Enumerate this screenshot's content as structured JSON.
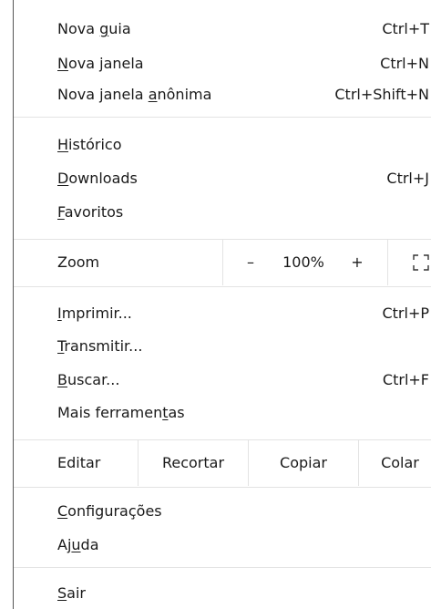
{
  "section1": [
    {
      "pre": "Nova ",
      "acc": "g",
      "post": "uia",
      "shortcut": "Ctrl+T"
    },
    {
      "pre": "",
      "acc": "N",
      "post": "ova janela",
      "shortcut": "Ctrl+N"
    },
    {
      "pre": "Nova janela ",
      "acc": "a",
      "post": "nônima",
      "shortcut": "Ctrl+Shift+N"
    }
  ],
  "section2": [
    {
      "pre": "",
      "acc": "H",
      "post": "istórico",
      "shortcut": ""
    },
    {
      "pre": "",
      "acc": "D",
      "post": "ownloads",
      "shortcut": "Ctrl+J"
    },
    {
      "pre": "",
      "acc": "F",
      "post": "avoritos",
      "shortcut": ""
    }
  ],
  "zoom": {
    "label": "Zoom",
    "minus": "–",
    "value": "100%",
    "plus": "+",
    "fullscreen_icon": "fullscreen-icon"
  },
  "section3": [
    {
      "pre": "",
      "acc": "I",
      "post": "mprimir...",
      "shortcut": "Ctrl+P"
    },
    {
      "pre": "",
      "acc": "T",
      "post": "ransmitir...",
      "shortcut": ""
    },
    {
      "pre": "",
      "acc": "B",
      "post": "uscar...",
      "shortcut": "Ctrl+F"
    },
    {
      "pre": "Mais ferramen",
      "acc": "t",
      "post": "as",
      "shortcut": ""
    }
  ],
  "edit": {
    "label": "Editar",
    "cut": "Recortar",
    "copy": "Copiar",
    "paste": "Colar"
  },
  "section4": [
    {
      "pre": "",
      "acc": "C",
      "post": "onfigurações",
      "shortcut": ""
    },
    {
      "pre": "Aj",
      "acc": "u",
      "post": "da",
      "shortcut": ""
    }
  ],
  "section5": [
    {
      "pre": "",
      "acc": "S",
      "post": "air",
      "shortcut": ""
    }
  ]
}
